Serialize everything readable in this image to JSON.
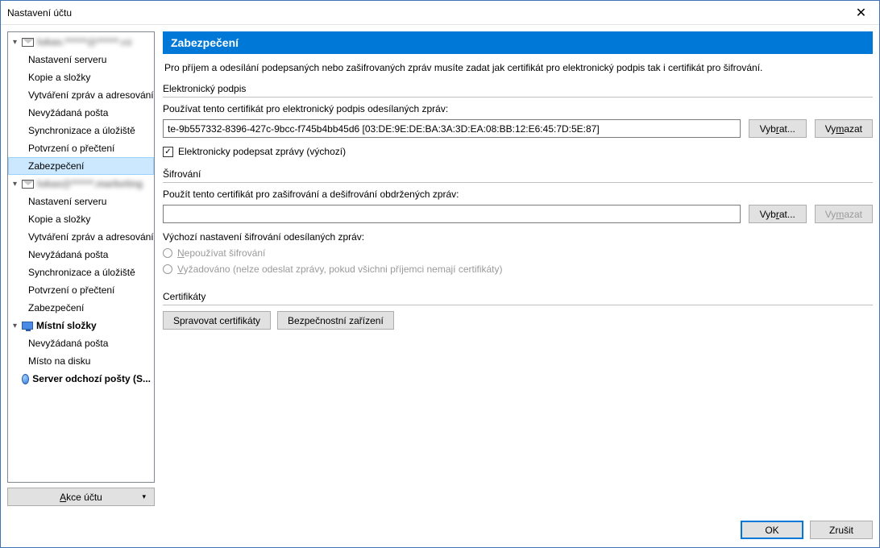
{
  "window": {
    "title": "Nastavení účtu"
  },
  "sidebar": {
    "account1": {
      "label": "lukas.******@******.cz"
    },
    "account2": {
      "label": "lukas@******.marketing"
    },
    "items": {
      "server": "Nastavení serveru",
      "copies": "Kopie a složky",
      "compose": "Vytváření zpráv a adresování",
      "junk": "Nevyžádaná pošta",
      "sync": "Synchronizace a úložiště",
      "receipts": "Potvrzení o přečtení",
      "security": "Zabezpečení",
      "local": "Místní složky",
      "disk": "Místo na disku",
      "smtp": "Server odchozí pošty (S..."
    },
    "actions": "Akce účtu"
  },
  "content": {
    "heading": "Zabezpečení",
    "intro": "Pro příjem a odesílání podepsaných nebo zašifrovaných zpráv musíte zadat jak certifikát pro elektronický podpis tak i certifikát pro šifrování.",
    "sign": {
      "group": "Elektronický podpis",
      "label": "Používat tento certifikát pro elektronický podpis odesílaných zpráv:",
      "value": "te-9b557332-8396-427c-9bcc-f745b4bb45d6 [03:DE:9E:DE:BA:3A:3D:EA:08:BB:12:E6:45:7D:5E:87]",
      "select": "Vybrat...",
      "clear": "Vymazat",
      "checkbox": "Elektronicky podepsat zprávy (výchozí)"
    },
    "encrypt": {
      "group": "Šifrování",
      "label": "Použít tento certifikát pro zašifrování a dešifrování obdržených zpráv:",
      "value": "",
      "select": "Vybrat...",
      "clear": "Vymazat",
      "defaultLabel": "Výchozí nastavení šifrování odesílaných zpráv:",
      "radio1": "Nepoužívat šifrování",
      "radio2": "Vyžadováno (nelze odeslat zprávy, pokud všichni příjemci nemají certifikáty)"
    },
    "certs": {
      "group": "Certifikáty",
      "manage": "Spravovat certifikáty",
      "devices": "Bezpečnostní zařízení"
    }
  },
  "footer": {
    "ok": "OK",
    "cancel": "Zrušit"
  }
}
